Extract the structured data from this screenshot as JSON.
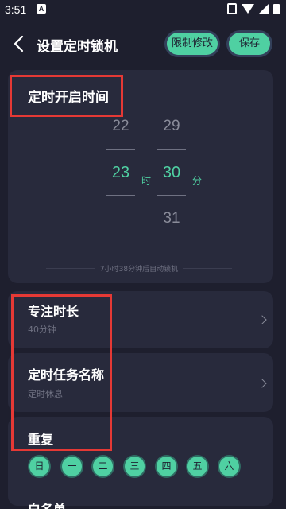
{
  "status_bar": {
    "time": "3:51",
    "notif_letter": "A"
  },
  "header": {
    "title": "设置定时锁机",
    "limit_button": "限制修改",
    "save_button": "保存"
  },
  "time_picker": {
    "title": "定时开启时间",
    "hours": {
      "above": "22",
      "selected": "23",
      "unit": "时"
    },
    "minutes": {
      "above": "29",
      "selected": "30",
      "below": "31",
      "unit": "分"
    },
    "auto_lock_text": "7小时38分钟后自动锁机"
  },
  "focus": {
    "title": "专注时长",
    "value": "40分钟"
  },
  "task": {
    "title": "定时任务名称",
    "value": "定时休息"
  },
  "repeat": {
    "title": "重复",
    "days": [
      "日",
      "一",
      "二",
      "三",
      "四",
      "五",
      "六"
    ]
  },
  "partial_bottom_text": "白名单",
  "colors": {
    "accent": "#4fd0a2",
    "background": "#1e1f2e",
    "card": "#282a3c",
    "highlight": "#e53935"
  }
}
